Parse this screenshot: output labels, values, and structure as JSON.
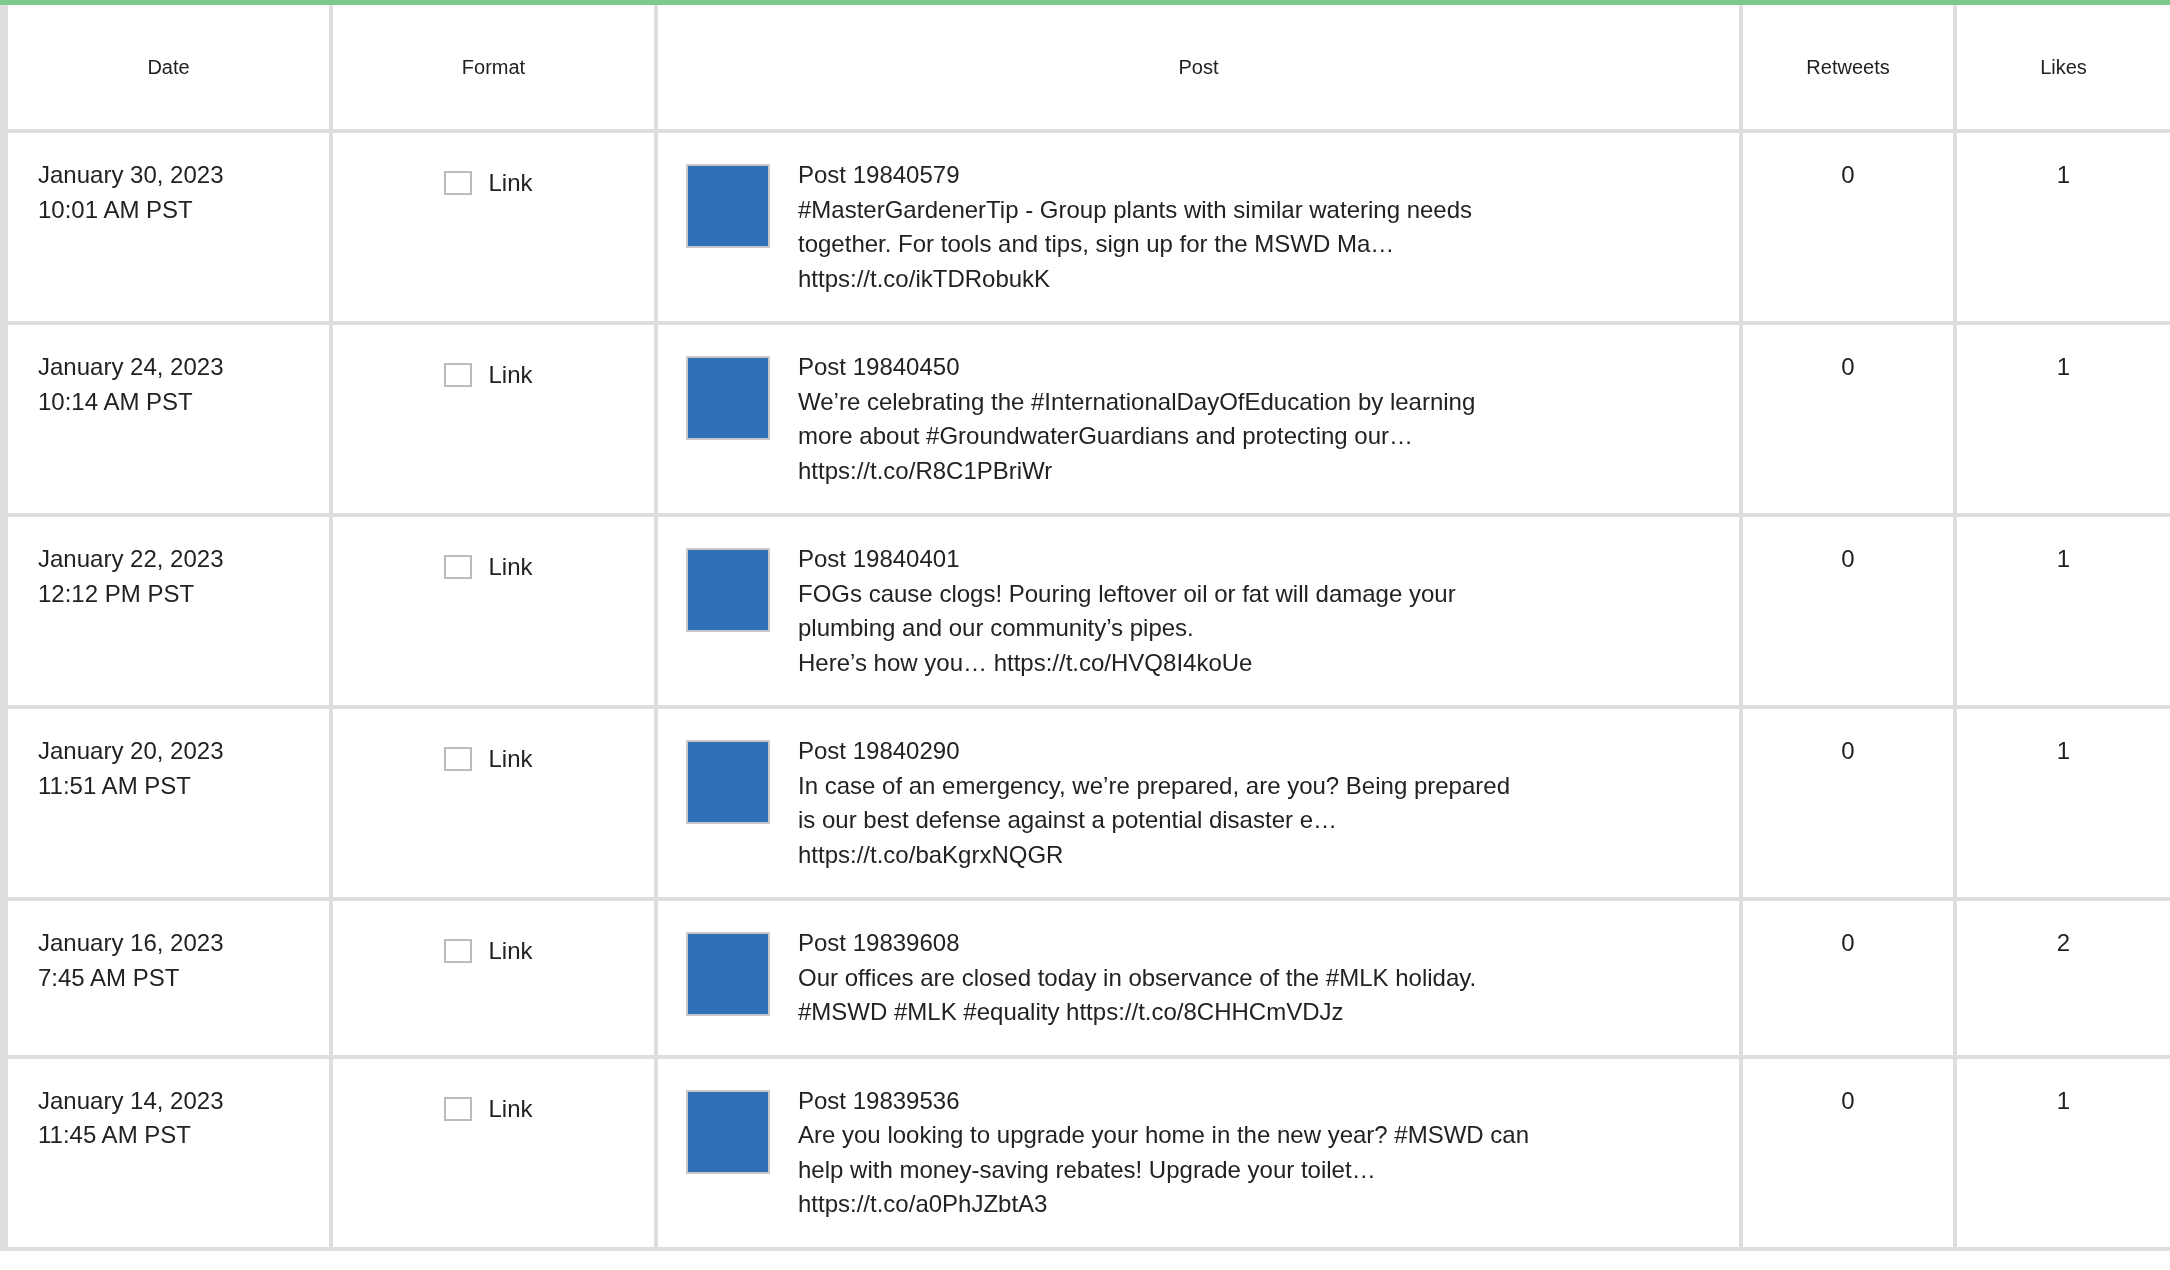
{
  "table": {
    "columns": [
      "Date",
      "Format",
      "Post",
      "Retweets",
      "Likes"
    ],
    "rows": [
      {
        "date": "January 30, 2023",
        "time": "10:01 AM PST",
        "format": {
          "label": "Link",
          "checked": false
        },
        "post": {
          "title": "Post 19840579",
          "lines": [
            "#MasterGardenerTip - Group plants with similar watering needs",
            "together. For tools and tips, sign up for the MSWD Ma…",
            "https://t.co/ikTDRobukK"
          ]
        },
        "retweets": "0",
        "likes": "1"
      },
      {
        "date": "January 24, 2023",
        "time": "10:14 AM PST",
        "format": {
          "label": "Link",
          "checked": false
        },
        "post": {
          "title": "Post 19840450",
          "lines": [
            "We’re celebrating the #InternationalDayOfEducation by learning",
            "more about #GroundwaterGuardians and protecting our…",
            "https://t.co/R8C1PBriWr"
          ]
        },
        "retweets": "0",
        "likes": "1"
      },
      {
        "date": "January 22, 2023",
        "time": "12:12 PM PST",
        "format": {
          "label": "Link",
          "checked": false
        },
        "post": {
          "title": "Post 19840401",
          "lines": [
            "FOGs cause clogs! Pouring leftover oil or fat will damage your",
            "plumbing and our community’s pipes.",
            "Here’s how you… https://t.co/HVQ8I4koUe"
          ]
        },
        "retweets": "0",
        "likes": "1"
      },
      {
        "date": "January 20, 2023",
        "time": "11:51 AM PST",
        "format": {
          "label": "Link",
          "checked": false
        },
        "post": {
          "title": "Post 19840290",
          "lines": [
            "In case of an emergency, we’re prepared, are you? Being prepared",
            "is our best defense against a potential disaster e…",
            "https://t.co/baKgrxNQGR"
          ]
        },
        "retweets": "0",
        "likes": "1"
      },
      {
        "date": "January 16, 2023",
        "time": "7:45 AM PST",
        "format": {
          "label": "Link",
          "checked": false
        },
        "post": {
          "title": "Post 19839608",
          "lines": [
            "Our offices are closed today in observance of the #MLK holiday.",
            "#MSWD #MLK #equality https://t.co/8CHHCmVDJz"
          ]
        },
        "retweets": "0",
        "likes": "2"
      },
      {
        "date": "January 14, 2023",
        "time": "11:45 AM PST",
        "format": {
          "label": "Link",
          "checked": false
        },
        "post": {
          "title": "Post 19839536",
          "lines": [
            "Are you looking to upgrade your home in the new year? #MSWD can",
            "help with money-saving rebates! Upgrade your toilet…",
            "https://t.co/a0PhJZbtA3"
          ]
        },
        "retweets": "0",
        "likes": "1"
      }
    ]
  }
}
